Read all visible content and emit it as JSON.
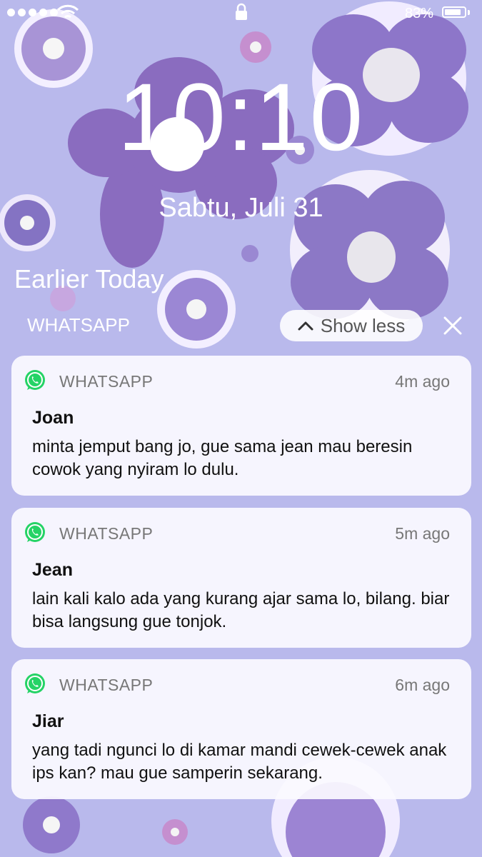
{
  "status_bar": {
    "battery_percent": "83%",
    "battery_level": 0.83,
    "signal_dots": 5
  },
  "lock_screen": {
    "time": "10:10",
    "date": "Sabtu, Juli 31",
    "earlier_today": "Earlier Today"
  },
  "notification_group": {
    "app_label": "WHATSAPP",
    "show_less_label": "Show less"
  },
  "notifications": [
    {
      "app": "WHATSAPP",
      "time": "4m ago",
      "sender": "Joan",
      "message": "minta jemput bang jo, gue sama jean mau beresin cowok yang nyiram lo dulu."
    },
    {
      "app": "WHATSAPP",
      "time": "5m ago",
      "sender": "Jean",
      "message": "lain kali kalo ada yang kurang ajar sama lo, bilang. biar bisa langsung gue tonjok."
    },
    {
      "app": "WHATSAPP",
      "time": "6m ago",
      "sender": "Jiar",
      "message": "yang tadi ngunci lo di kamar mandi cewek-cewek anak ips kan? mau gue samperin sekarang."
    }
  ],
  "colors": {
    "wallpaper": "#b9b9ec",
    "flower_dark": "#7d62b8",
    "flower_light": "#a795d6",
    "whatsapp_green": "#25d366"
  }
}
